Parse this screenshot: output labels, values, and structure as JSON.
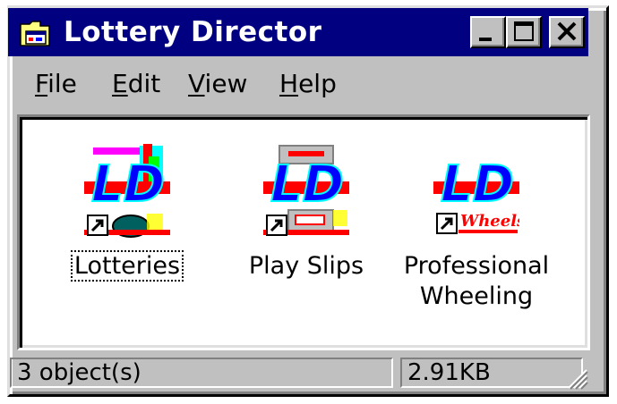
{
  "window": {
    "title": "Lottery Director",
    "icon": "folder-window-icon"
  },
  "title_buttons": {
    "minimize_icon": "minimize-icon",
    "maximize_icon": "maximize-icon",
    "close_icon": "close-icon"
  },
  "menu": {
    "items": [
      {
        "accel": "F",
        "rest": "ile"
      },
      {
        "accel": "E",
        "rest": "dit"
      },
      {
        "accel": "V",
        "rest": "iew"
      },
      {
        "accel": "H",
        "rest": "elp"
      }
    ]
  },
  "icons": [
    {
      "label": "Lotteries",
      "icon": "ld-lotteries-shortcut-icon",
      "logo": "LD",
      "selected": true
    },
    {
      "label": "Play Slips",
      "icon": "ld-play-slips-shortcut-icon",
      "logo": "LD",
      "selected": false
    },
    {
      "label_lines": [
        "Professional",
        "Wheeling"
      ],
      "icon": "ld-wheels-shortcut-icon",
      "logo": "LD",
      "badge": "Wheels",
      "selected": false
    }
  ],
  "status": {
    "objects": "3 object(s)",
    "size": "2.91KB"
  },
  "colors": {
    "titlebar": "#000080",
    "face": "#c0c0c0",
    "logo_blue": "#0000ff",
    "logo_red": "#ff0000",
    "logo_yellow": "#ffff00"
  }
}
